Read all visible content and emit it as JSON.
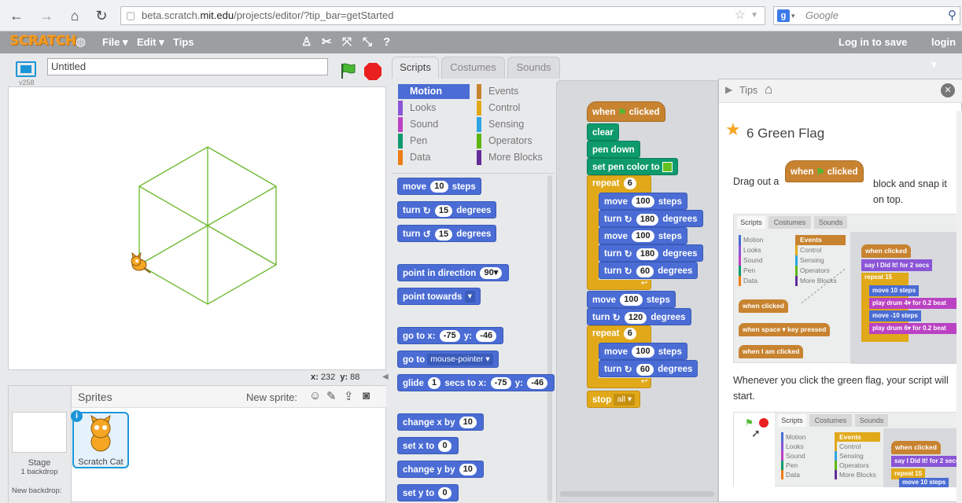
{
  "browser": {
    "url_prefix": "beta.scratch.",
    "url_domain": "mit.edu",
    "url_path": "/projects/editor/?tip_bar=getStarted",
    "search_placeholder": "Google",
    "search_engine": "g"
  },
  "menu": {
    "logo": "SCRATCH",
    "file": "File ▾",
    "edit": "Edit ▾",
    "tips": "Tips",
    "login_save": "Log in to save",
    "login": "login ▾"
  },
  "stage": {
    "version": "v258",
    "title": "Untitled",
    "x_label": "x:",
    "x_value": "232",
    "y_label": "y:",
    "y_value": "88"
  },
  "sprites": {
    "header": "Sprites",
    "new_sprite": "New sprite:",
    "stage_label": "Stage",
    "stage_sub": "1 backdrop",
    "new_backdrop": "New backdrop:",
    "cat_name": "Scratch Cat",
    "info": "i"
  },
  "tabs": {
    "scripts": "Scripts",
    "costumes": "Costumes",
    "sounds": "Sounds"
  },
  "categories": {
    "motion": "Motion",
    "looks": "Looks",
    "sound": "Sound",
    "pen": "Pen",
    "data": "Data",
    "events": "Events",
    "control": "Control",
    "sensing": "Sensing",
    "operators": "Operators",
    "more": "More Blocks"
  },
  "palette": {
    "move": "move",
    "move_n": "10",
    "steps": "steps",
    "turn": "turn",
    "turn_n": "15",
    "degrees": "degrees",
    "point_dir": "point in direction",
    "point_dir_n": "90▾",
    "point_towards": "point towards",
    "point_towards_d": "▾",
    "goto": "go to x:",
    "goto_x": "-75",
    "y": "y:",
    "goto_y": "-46",
    "goto2": "go to",
    "goto2_d": "mouse-pointer ▾",
    "glide": "glide",
    "glide_n": "1",
    "glide_secs": "secs to x:",
    "glide_x": "-75",
    "glide_y": "-46",
    "change_x": "change x by",
    "change_x_n": "10",
    "set_x": "set x to",
    "set_x_n": "0",
    "change_y": "change y by",
    "change_y_n": "10",
    "set_y": "set y to",
    "set_y_n": "0"
  },
  "script": {
    "when": "when",
    "clicked": "clicked",
    "clear": "clear",
    "pen_down": "pen down",
    "set_pen_color": "set pen color to",
    "repeat": "repeat",
    "repeat_n": "6",
    "move": "move",
    "move_n": "100",
    "steps": "steps",
    "turn": "turn",
    "t180": "180",
    "t60": "60",
    "t120": "120",
    "degrees": "degrees",
    "stop": "stop",
    "stop_d": "all ▾"
  },
  "tips": {
    "header": "Tips",
    "heading": "6 Green Flag",
    "p1a": "Drag out a",
    "p1b": "block and snap it on top.",
    "p2": "Whenever you click the green flag, your script will start.",
    "mini_tabs": [
      "Scripts",
      "Costumes",
      "Sounds"
    ],
    "mini_cats_left": [
      "Motion",
      "Looks",
      "Sound",
      "Pen",
      "Data"
    ],
    "mini_cats_right": [
      "Events",
      "Control",
      "Sensing",
      "Operators",
      "More Blocks"
    ],
    "mini_blocks": {
      "when_clicked": "when   clicked",
      "when_key": "when space ▾ key pressed",
      "when_sprite": "when I am clicked",
      "say": "say  I Did It!  for  2  secs",
      "repeat": "repeat  15",
      "move10": "move  10  steps",
      "drum1": "play drum  4▾  for  0.2  beat",
      "move_10": "move  -10  steps",
      "drum2": "play drum  6▾  for  0.2  beat"
    }
  },
  "colors": {
    "motion": "#4a6cd4",
    "looks": "#8a55d7",
    "sound": "#bb42c3",
    "pen": "#0e9a6c",
    "data": "#ee7d16",
    "events": "#c88330",
    "control": "#e1a91a",
    "sensing": "#2ca5e2",
    "operators": "#5cb712",
    "more": "#632d99",
    "accent_blue": "#1a96d8"
  }
}
